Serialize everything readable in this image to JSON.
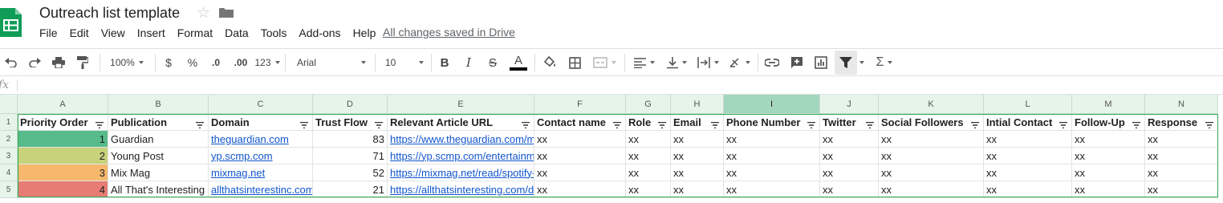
{
  "doc": {
    "title": "Outreach list template",
    "save_status": "All changes saved in Drive"
  },
  "menu": [
    "File",
    "Edit",
    "View",
    "Insert",
    "Format",
    "Data",
    "Tools",
    "Add-ons",
    "Help"
  ],
  "toolbar": {
    "zoom": "100%",
    "currency": "$",
    "percent": "%",
    "decimal_decrease": ".0",
    "decimal_increase": ".00",
    "more_formats": "123",
    "font": "Arial",
    "font_size": "10",
    "bold": "B",
    "italic": "I",
    "strike": "S",
    "text_color": "A",
    "text_color_hex": "#000000",
    "sum": "Σ"
  },
  "formula_bar": {
    "fx": "fx"
  },
  "columns": [
    "A",
    "B",
    "C",
    "D",
    "E",
    "F",
    "G",
    "H",
    "I",
    "J",
    "K",
    "L",
    "M",
    "N"
  ],
  "selected_column": "I",
  "row_numbers": [
    "1",
    "2",
    "3",
    "4",
    "5"
  ],
  "header_row": [
    "Priority Order",
    "Publication",
    "Domain",
    "Trust Flow",
    "Relevant Article URL",
    "Contact name",
    "Role",
    "Email",
    "Phone Number",
    "Twitter",
    "Social Followers",
    "Intial Contact",
    "Follow-Up",
    "Response"
  ],
  "rows": [
    {
      "priority": "1",
      "publication": "Guardian",
      "domain": "theguardian.com",
      "trust_flow": "83",
      "url": "https://www.theguardian.com/m",
      "contact": "xx",
      "role": "xx",
      "email": "xx",
      "phone": "xx",
      "twitter": "xx",
      "followers": "xx",
      "initial": "xx",
      "followup": "xx",
      "response": "xx",
      "color": "#57bb8a"
    },
    {
      "priority": "2",
      "publication": "Young Post",
      "domain": "yp.scmp.com",
      "trust_flow": "71",
      "url": "https://yp.scmp.com/entertainm",
      "contact": "xx",
      "role": "xx",
      "email": "xx",
      "phone": "xx",
      "twitter": "xx",
      "followers": "xx",
      "initial": "xx",
      "followup": "xx",
      "response": "xx",
      "color": "#c7d27a"
    },
    {
      "priority": "3",
      "publication": "Mix Mag",
      "domain": "mixmag.net",
      "trust_flow": "52",
      "url": "https://mixmag.net/read/spotify-",
      "contact": "xx",
      "role": "xx",
      "email": "xx",
      "phone": "xx",
      "twitter": "xx",
      "followers": "xx",
      "initial": "xx",
      "followup": "xx",
      "response": "xx",
      "color": "#f6b86c"
    },
    {
      "priority": "4",
      "publication": "All That's Interesting",
      "domain": "allthatsinterestinc.com",
      "trust_flow": "21",
      "url": "https://allthatsinteresting.com/d",
      "contact": "xx",
      "role": "xx",
      "email": "xx",
      "phone": "xx",
      "twitter": "xx",
      "followers": "xx",
      "initial": "xx",
      "followup": "xx",
      "response": "xx",
      "color": "#e67c73"
    }
  ]
}
